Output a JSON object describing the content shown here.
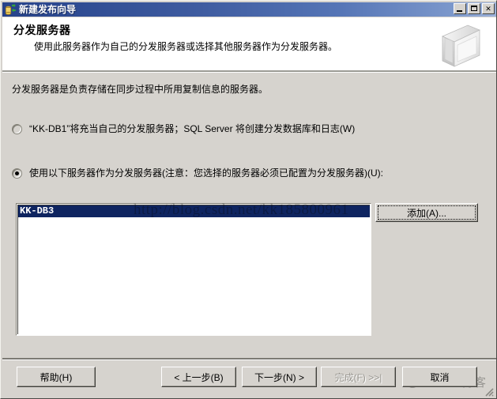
{
  "window": {
    "title": "新建发布向导",
    "icon": "replication-database-icon",
    "controls": {
      "minimize": "_",
      "maximize": "□",
      "close": "✕"
    }
  },
  "header": {
    "title": "分发服务器",
    "subtitle": "使用此服务器作为自己的分发服务器或选择其他服务器作为分发服务器。",
    "icon": "server-box-icon"
  },
  "body": {
    "description": "分发服务器是负责存储在同步过程中所用复制信息的服务器。",
    "options": [
      {
        "id": "self-distributor",
        "label": "“KK-DB1”将充当自己的分发服务器；SQL Server 将创建分发数据库和日志(W)",
        "checked": false
      },
      {
        "id": "other-distributor",
        "label": "使用以下服务器作为分发服务器(注意：您选择的服务器必须已配置为分发服务器)(U):",
        "checked": true
      }
    ],
    "server_list": {
      "items": [
        "KK-DB3"
      ],
      "selected": "KK-DB3"
    },
    "add_button": "添加(A)..."
  },
  "footer": {
    "help": "帮助(H)",
    "back": "< 上一步(B)",
    "next": "下一步(N) >",
    "finish": "完成(F) >>|",
    "cancel": "取消"
  },
  "watermarks": {
    "url": "http://blog.csdn.net/kk185800961",
    "site": "@51CTO博客"
  },
  "colors": {
    "titlebar_start": "#26428a",
    "titlebar_end": "#9db2da",
    "dialog_face": "#d6d3ce",
    "selection": "#0e2460",
    "text": "#000000",
    "disabled_text": "#9a9892"
  }
}
